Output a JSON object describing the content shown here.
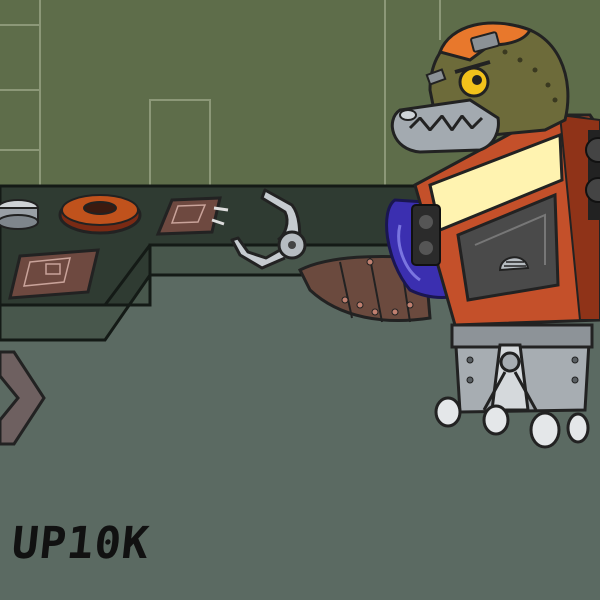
{
  "game": {
    "scene": "robot-factory-workshop",
    "hud": {
      "code_text": "UP10K"
    },
    "colors": {
      "wall": "#5e6d4a",
      "floor": "#5b6a62",
      "robot_body": "#c4502a",
      "robot_screen": "#fff3b0",
      "robot_head": "#6d6b3a",
      "helmet": "#e8782c",
      "arm": "#6b4a3e"
    },
    "icons": [
      "claw-arm-icon",
      "gear-icon",
      "speaker-icon",
      "exit-arrow-icon"
    ]
  }
}
